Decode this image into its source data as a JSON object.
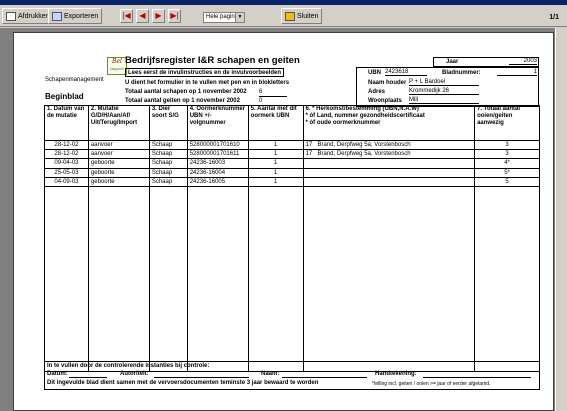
{
  "toolbar": {
    "print_label": "Afdrukken",
    "export_label": "Exporteren",
    "zoom_value": "Hele pagina",
    "close_label": "Sluiten",
    "page_count": "1/1"
  },
  "report": {
    "title": "Bedrijfsregister I&R schapen en geiten",
    "logo_text": "Bel",
    "logo_sub": "Import",
    "brand": "Schapenmanagement",
    "section": "Beginblad",
    "instruction_box": "Lees eerst de invulinstructies en de invulvoorbeelden",
    "instruction_line": "U dient het formulier in te vullen met pen en in blokletters",
    "total_sheep_label": "Totaal aantal schapen op 1 november 2002",
    "total_sheep_value": "6",
    "total_goats_label": "Totaal aantal geiten op 1 november 2002",
    "total_goats_value": "0",
    "jaar_label": "Jaar",
    "jaar_value": "2003",
    "bladnummer_label": "Bladnummer:",
    "bladnummer_value": "1",
    "ubn_label": "UBN",
    "ubn_value": "2423618",
    "houder_label": "Naam houder",
    "houder_value": "P + L Bardoel",
    "adres_label": "Adres",
    "adres_value": "Krommedijk 26",
    "woonplaats_label": "Woonplaats",
    "woonplaats_value": "Mill"
  },
  "table": {
    "headers": [
      "1. Datum van de mutatie",
      "2. Mutatie G/D/H/Aan/Af/ Uit/Terug/Import",
      "3. Dier soort S/G",
      "4. Oormerknummer UBN +/- volgnummer",
      "5. Aantal met dit oormerk UBN",
      "6.   *   Herkomst/bestemming (UBN,N.A.W)\n      *   óf Land, nummer gezondheidscertificaat\n      *   óf oude oormerknummer",
      "7. Totaal aantal ooien/geiten aanwezig"
    ],
    "rows": [
      {
        "datum": "28-12-02",
        "mutatie": "aanvoer",
        "soort": "Schaap",
        "oormerk": "528000001701610",
        "aantal": "1",
        "herkomst_nr": "17",
        "herkomst": "Brand, Derpfweg 5a, Vorstenbosch",
        "totaal": "3"
      },
      {
        "datum": "28-12-02",
        "mutatie": "aanvoer",
        "soort": "Schaap",
        "oormerk": "528000001701611",
        "aantal": "1",
        "herkomst_nr": "17",
        "herkomst": "Brand, Derpfweg 5a, Vorstenbosch",
        "totaal": "3"
      },
      {
        "datum": "09-04-03",
        "mutatie": "geboorte",
        "soort": "Schaap",
        "oormerk": "24236-16003",
        "aantal": "1",
        "herkomst_nr": "",
        "herkomst": "",
        "totaal": "4*"
      },
      {
        "datum": "25-05-03",
        "mutatie": "geboorte",
        "soort": "Schaap",
        "oormerk": "24236-16004",
        "aantal": "1",
        "herkomst_nr": "",
        "herkomst": "",
        "totaal": "5*"
      },
      {
        "datum": "04-09-03",
        "mutatie": "geboorte",
        "soort": "Schaap",
        "oormerk": "24236-16005",
        "aantal": "1",
        "herkomst_nr": "",
        "herkomst": "",
        "totaal": "5"
      }
    ]
  },
  "footer": {
    "line1": "In te vullen door de controlerende instanties bij controle:",
    "datum": "Datum:",
    "autoriteit": "Autoriteit:",
    "naam": "Naam:",
    "handtekening": "Handtekening:",
    "line3": "Dit ingevulde blad dient samen met de vervoersdocumenten teminste 3 jaar bewaard te worden",
    "note": "*telling incl. geiten / ooien >= jaar of eerder afgelamd."
  }
}
